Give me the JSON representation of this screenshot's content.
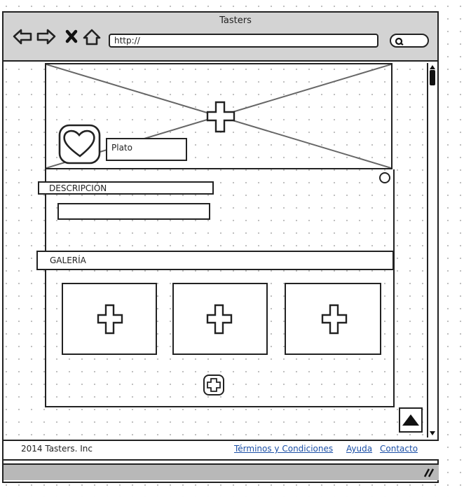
{
  "browser": {
    "title": "Tasters",
    "url": "http://"
  },
  "hero": {
    "dish_label": "Plato"
  },
  "sections": {
    "description_label": "DESCRIPCIÓN",
    "gallery_label": "GALERÍA"
  },
  "footer": {
    "copyright": "2014 Tasters. Inc",
    "links": [
      "Términos y Condiciones",
      "Ayuda",
      "Contacto"
    ]
  },
  "icons": {
    "back": "back-arrow-icon",
    "forward": "forward-arrow-icon",
    "stop": "stop-x-icon",
    "home": "home-icon",
    "search": "search-icon",
    "favorite": "heart-icon",
    "add": "plus-icon",
    "scroll_top": "up-triangle-icon"
  },
  "colors": {
    "chrome_gray": "#d3d3d3",
    "link_blue": "#1b4fa6"
  }
}
